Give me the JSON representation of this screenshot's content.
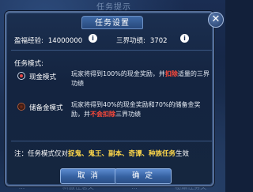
{
  "background": {
    "title": "任务提示",
    "bottom_items": [
      "...",
      "新服任意文",
      "...",
      "秘籍任务文"
    ]
  },
  "dialog": {
    "title": "任务设置",
    "close_icon": "close-icon",
    "stats": {
      "blessing_exp_label": "盈福经验:",
      "blessing_exp_value": "14000000",
      "merit_label": "三界功绩:",
      "merit_value": "3702"
    },
    "mode_section_title": "任务模式:",
    "modes": [
      {
        "name": "现金模式",
        "selected": true,
        "desc_part1": "玩家将得到100%的现金奖励，并",
        "desc_red": "扣除",
        "desc_part2": "适量的三界功绩"
      },
      {
        "name": "储备金模式",
        "selected": false,
        "desc_part1": "玩家将得到40%的现金奖励和70%的储备金奖励，并",
        "desc_red": "不会扣除",
        "desc_part2": "三界功绩"
      }
    ],
    "note": {
      "prefix": "注：任务模式仅对",
      "highlight": "捉鬼、鬼王、副本、奇谭、种族任务",
      "suffix": "生效"
    },
    "buttons": {
      "cancel": "取 消",
      "confirm": "确 定"
    }
  },
  "colors": {
    "highlight_red": "#ff4a3a",
    "highlight_yellow": "#ffd84a",
    "button_blue": "#35609f"
  }
}
